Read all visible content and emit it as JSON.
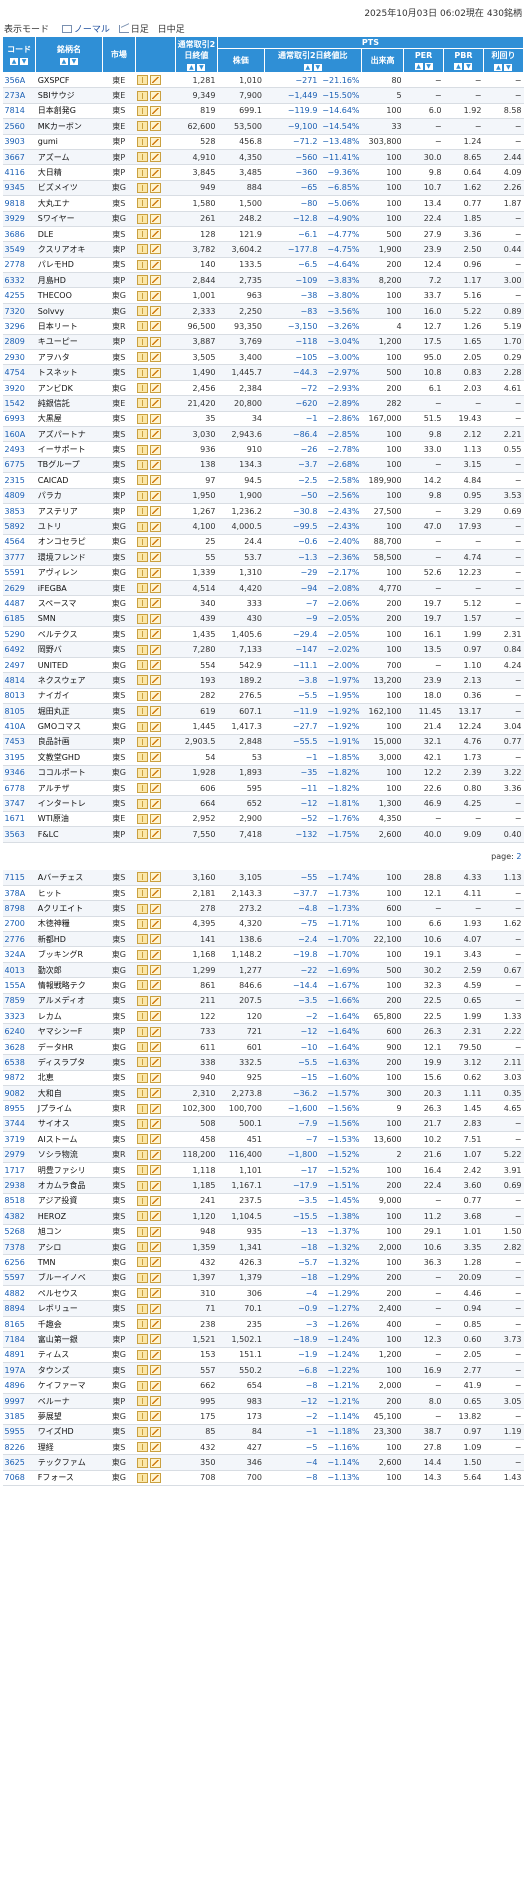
{
  "header": {
    "view_mode_label": "表示モード",
    "mode_normal": "ノーマル",
    "mode_daily": "日足",
    "mode_intraday": "日中足",
    "timestamp": "2025年10月03日 06:02現在",
    "count": "430銘柄"
  },
  "columns": {
    "code": "コード",
    "name": "銘柄名",
    "market": "市場",
    "regular_close": "通常取引2日終値",
    "pts_group": "PTS",
    "price": "株価",
    "ratio": "通常取引2日終値比",
    "volume": "出来高",
    "per": "PER",
    "pbr": "PBR",
    "yield": "利回り"
  },
  "colors": {
    "header_bg": "#2f8fd6",
    "negative": "#1a5fb4",
    "code": "#1a5fb4"
  },
  "icons": [
    "book-icon",
    "chart-icon"
  ],
  "page_label": "page:",
  "page_number": "2",
  "rows": [
    [
      "356A",
      "GXSPCF",
      "東E",
      "1,281",
      "1,010",
      "−271",
      "−21.16%",
      "80",
      "−",
      "−",
      "−"
    ],
    [
      "273A",
      "SBIサウジ",
      "東E",
      "9,349",
      "7,900",
      "−1,449",
      "−15.50%",
      "5",
      "−",
      "−",
      "−"
    ],
    [
      "7814",
      "日本創発G",
      "東S",
      "819",
      "699.1",
      "−119.9",
      "−14.64%",
      "100",
      "6.0",
      "1.92",
      "8.58"
    ],
    [
      "2560",
      "MKカーボン",
      "東E",
      "62,600",
      "53,500",
      "−9,100",
      "−14.54%",
      "33",
      "−",
      "−",
      "−"
    ],
    [
      "3903",
      "gumi",
      "東P",
      "528",
      "456.8",
      "−71.2",
      "−13.48%",
      "303,800",
      "−",
      "1.24",
      "−"
    ],
    [
      "3667",
      "アズーム",
      "東P",
      "4,910",
      "4,350",
      "−560",
      "−11.41%",
      "100",
      "30.0",
      "8.65",
      "2.44"
    ],
    [
      "4116",
      "大日精",
      "東P",
      "3,845",
      "3,485",
      "−360",
      "−9.36%",
      "100",
      "9.8",
      "0.64",
      "4.09"
    ],
    [
      "9345",
      "ビズメイツ",
      "東G",
      "949",
      "884",
      "−65",
      "−6.85%",
      "100",
      "10.7",
      "1.62",
      "2.26"
    ],
    [
      "9818",
      "大丸エナ",
      "東S",
      "1,580",
      "1,500",
      "−80",
      "−5.06%",
      "100",
      "13.4",
      "0.77",
      "1.87"
    ],
    [
      "3929",
      "Sワイヤー",
      "東G",
      "261",
      "248.2",
      "−12.8",
      "−4.90%",
      "100",
      "22.4",
      "1.85",
      "−"
    ],
    [
      "3686",
      "DLE",
      "東S",
      "128",
      "121.9",
      "−6.1",
      "−4.77%",
      "500",
      "27.9",
      "3.36",
      "−"
    ],
    [
      "3549",
      "クスリアオキ",
      "東P",
      "3,782",
      "3,604.2",
      "−177.8",
      "−4.75%",
      "1,900",
      "23.9",
      "2.50",
      "0.44"
    ],
    [
      "2778",
      "パレモHD",
      "東S",
      "140",
      "133.5",
      "−6.5",
      "−4.64%",
      "200",
      "12.4",
      "0.96",
      "−"
    ],
    [
      "6332",
      "月島HD",
      "東P",
      "2,844",
      "2,735",
      "−109",
      "−3.83%",
      "8,200",
      "7.2",
      "1.17",
      "3.00"
    ],
    [
      "4255",
      "THECOO",
      "東G",
      "1,001",
      "963",
      "−38",
      "−3.80%",
      "100",
      "33.7",
      "5.16",
      "−"
    ],
    [
      "7320",
      "Solvvy",
      "東G",
      "2,333",
      "2,250",
      "−83",
      "−3.56%",
      "100",
      "16.0",
      "5.22",
      "0.89"
    ],
    [
      "3296",
      "日本リート",
      "東R",
      "96,500",
      "93,350",
      "−3,150",
      "−3.26%",
      "4",
      "12.7",
      "1.26",
      "5.19"
    ],
    [
      "2809",
      "キユーピー",
      "東P",
      "3,887",
      "3,769",
      "−118",
      "−3.04%",
      "1,200",
      "17.5",
      "1.65",
      "1.70"
    ],
    [
      "2930",
      "アヲハタ",
      "東S",
      "3,505",
      "3,400",
      "−105",
      "−3.00%",
      "100",
      "95.0",
      "2.05",
      "0.29"
    ],
    [
      "4754",
      "トスネット",
      "東S",
      "1,490",
      "1,445.7",
      "−44.3",
      "−2.97%",
      "500",
      "10.8",
      "0.83",
      "2.28"
    ],
    [
      "3920",
      "アンビDK",
      "東G",
      "2,456",
      "2,384",
      "−72",
      "−2.93%",
      "200",
      "6.1",
      "2.03",
      "4.61"
    ],
    [
      "1542",
      "純銀信託",
      "東E",
      "21,420",
      "20,800",
      "−620",
      "−2.89%",
      "282",
      "−",
      "−",
      "−"
    ],
    [
      "6993",
      "大黒屋",
      "東S",
      "35",
      "34",
      "−1",
      "−2.86%",
      "167,000",
      "51.5",
      "19.43",
      "−"
    ],
    [
      "160A",
      "アズパートナ",
      "東S",
      "3,030",
      "2,943.6",
      "−86.4",
      "−2.85%",
      "100",
      "9.8",
      "2.12",
      "2.21"
    ],
    [
      "2493",
      "イーサポート",
      "東S",
      "936",
      "910",
      "−26",
      "−2.78%",
      "100",
      "33.0",
      "1.13",
      "0.55"
    ],
    [
      "6775",
      "TBグループ",
      "東S",
      "138",
      "134.3",
      "−3.7",
      "−2.68%",
      "100",
      "−",
      "3.15",
      "−"
    ],
    [
      "2315",
      "CAICAD",
      "東S",
      "97",
      "94.5",
      "−2.5",
      "−2.58%",
      "189,900",
      "14.2",
      "4.84",
      "−"
    ],
    [
      "4809",
      "パラカ",
      "東P",
      "1,950",
      "1,900",
      "−50",
      "−2.56%",
      "100",
      "9.8",
      "0.95",
      "3.53"
    ],
    [
      "3853",
      "アステリア",
      "東P",
      "1,267",
      "1,236.2",
      "−30.8",
      "−2.43%",
      "27,500",
      "−",
      "3.29",
      "0.69"
    ],
    [
      "5892",
      "ユトリ",
      "東G",
      "4,100",
      "4,000.5",
      "−99.5",
      "−2.43%",
      "100",
      "47.0",
      "17.93",
      "−"
    ],
    [
      "4564",
      "オンコセラピ",
      "東G",
      "25",
      "24.4",
      "−0.6",
      "−2.40%",
      "88,700",
      "−",
      "−",
      "−"
    ],
    [
      "3777",
      "環境フレンド",
      "東S",
      "55",
      "53.7",
      "−1.3",
      "−2.36%",
      "58,500",
      "−",
      "4.74",
      "−"
    ],
    [
      "5591",
      "アヴィレン",
      "東G",
      "1,339",
      "1,310",
      "−29",
      "−2.17%",
      "100",
      "52.6",
      "12.23",
      "−"
    ],
    [
      "2629",
      "iFEGBA",
      "東E",
      "4,514",
      "4,420",
      "−94",
      "−2.08%",
      "4,770",
      "−",
      "−",
      "−"
    ],
    [
      "4487",
      "スペースマ",
      "東G",
      "340",
      "333",
      "−7",
      "−2.06%",
      "200",
      "19.7",
      "5.12",
      "−"
    ],
    [
      "6185",
      "SMN",
      "東S",
      "439",
      "430",
      "−9",
      "−2.05%",
      "200",
      "19.7",
      "1.57",
      "−"
    ],
    [
      "5290",
      "ベルテクス",
      "東S",
      "1,435",
      "1,405.6",
      "−29.4",
      "−2.05%",
      "100",
      "16.1",
      "1.99",
      "2.31"
    ],
    [
      "6492",
      "岡野バ",
      "東S",
      "7,280",
      "7,133",
      "−147",
      "−2.02%",
      "100",
      "13.5",
      "0.97",
      "0.84"
    ],
    [
      "2497",
      "UNITED",
      "東G",
      "554",
      "542.9",
      "−11.1",
      "−2.00%",
      "700",
      "−",
      "1.10",
      "4.24"
    ],
    [
      "4814",
      "ネクスウェア",
      "東S",
      "193",
      "189.2",
      "−3.8",
      "−1.97%",
      "13,200",
      "23.9",
      "2.13",
      "−"
    ],
    [
      "8013",
      "ナイガイ",
      "東S",
      "282",
      "276.5",
      "−5.5",
      "−1.95%",
      "100",
      "18.0",
      "0.36",
      "−"
    ],
    [
      "8105",
      "堀田丸正",
      "東S",
      "619",
      "607.1",
      "−11.9",
      "−1.92%",
      "162,100",
      "11.45",
      "13.17",
      "−"
    ],
    [
      "410A",
      "GMOコマス",
      "東G",
      "1,445",
      "1,417.3",
      "−27.7",
      "−1.92%",
      "100",
      "21.4",
      "12.24",
      "3.04"
    ],
    [
      "7453",
      "良品計画",
      "東P",
      "2,903.5",
      "2,848",
      "−55.5",
      "−1.91%",
      "15,000",
      "32.1",
      "4.76",
      "0.77"
    ],
    [
      "3195",
      "文教堂GHD",
      "東S",
      "54",
      "53",
      "−1",
      "−1.85%",
      "3,000",
      "42.1",
      "1.73",
      "−"
    ],
    [
      "9346",
      "ココルポート",
      "東G",
      "1,928",
      "1,893",
      "−35",
      "−1.82%",
      "100",
      "12.2",
      "2.39",
      "3.22"
    ],
    [
      "6778",
      "アルチザ",
      "東S",
      "606",
      "595",
      "−11",
      "−1.82%",
      "100",
      "22.6",
      "0.80",
      "3.36"
    ],
    [
      "3747",
      "インタートレ",
      "東S",
      "664",
      "652",
      "−12",
      "−1.81%",
      "1,300",
      "46.9",
      "4.25",
      "−"
    ],
    [
      "1671",
      "WTI原油",
      "東E",
      "2,952",
      "2,900",
      "−52",
      "−1.76%",
      "4,350",
      "−",
      "−",
      "−"
    ],
    [
      "3563",
      "F&LC",
      "東P",
      "7,550",
      "7,418",
      "−132",
      "−1.75%",
      "2,600",
      "40.0",
      "9.09",
      "0.40"
    ],
    [
      "PAGE"
    ],
    [
      "7115",
      "Aバーチェス",
      "東S",
      "3,160",
      "3,105",
      "−55",
      "−1.74%",
      "100",
      "28.8",
      "4.33",
      "1.13"
    ],
    [
      "378A",
      "ヒット",
      "東S",
      "2,181",
      "2,143.3",
      "−37.7",
      "−1.73%",
      "100",
      "12.1",
      "4.11",
      "−"
    ],
    [
      "8798",
      "Aクリエイト",
      "東S",
      "278",
      "273.2",
      "−4.8",
      "−1.73%",
      "600",
      "−",
      "−",
      "−"
    ],
    [
      "2700",
      "木徳神糧",
      "東S",
      "4,395",
      "4,320",
      "−75",
      "−1.71%",
      "100",
      "6.6",
      "1.93",
      "1.62"
    ],
    [
      "2776",
      "新都HD",
      "東S",
      "141",
      "138.6",
      "−2.4",
      "−1.70%",
      "22,100",
      "10.6",
      "4.07",
      "−"
    ],
    [
      "324A",
      "ブッキングR",
      "東G",
      "1,168",
      "1,148.2",
      "−19.8",
      "−1.70%",
      "100",
      "19.1",
      "3.43",
      "−"
    ],
    [
      "4013",
      "勤次郎",
      "東G",
      "1,299",
      "1,277",
      "−22",
      "−1.69%",
      "500",
      "30.2",
      "2.59",
      "0.67"
    ],
    [
      "155A",
      "情報戦略テク",
      "東G",
      "861",
      "846.6",
      "−14.4",
      "−1.67%",
      "100",
      "32.3",
      "4.59",
      "−"
    ],
    [
      "7859",
      "アルメディオ",
      "東S",
      "211",
      "207.5",
      "−3.5",
      "−1.66%",
      "200",
      "22.5",
      "0.65",
      "−"
    ],
    [
      "3323",
      "レカム",
      "東S",
      "122",
      "120",
      "−2",
      "−1.64%",
      "65,800",
      "22.5",
      "1.99",
      "1.33"
    ],
    [
      "6240",
      "ヤマシンーF",
      "東P",
      "733",
      "721",
      "−12",
      "−1.64%",
      "600",
      "26.3",
      "2.31",
      "2.22"
    ],
    [
      "3628",
      "データHR",
      "東G",
      "611",
      "601",
      "−10",
      "−1.64%",
      "900",
      "12.1",
      "79.50",
      "−"
    ],
    [
      "6538",
      "ディスラプタ",
      "東S",
      "338",
      "332.5",
      "−5.5",
      "−1.63%",
      "200",
      "19.9",
      "3.12",
      "2.11"
    ],
    [
      "9872",
      "北恵",
      "東S",
      "940",
      "925",
      "−15",
      "−1.60%",
      "100",
      "15.6",
      "0.62",
      "3.03"
    ],
    [
      "9082",
      "大和自",
      "東S",
      "2,310",
      "2,273.8",
      "−36.2",
      "−1.57%",
      "300",
      "20.3",
      "1.11",
      "0.35"
    ],
    [
      "8955",
      "Jプライム",
      "東R",
      "102,300",
      "100,700",
      "−1,600",
      "−1.56%",
      "9",
      "26.3",
      "1.45",
      "4.65"
    ],
    [
      "3744",
      "サイオス",
      "東S",
      "508",
      "500.1",
      "−7.9",
      "−1.56%",
      "100",
      "21.7",
      "2.83",
      "−"
    ],
    [
      "3719",
      "AIストーム",
      "東S",
      "458",
      "451",
      "−7",
      "−1.53%",
      "13,600",
      "10.2",
      "7.51",
      "−"
    ],
    [
      "2979",
      "ソシラ物流",
      "東R",
      "118,200",
      "116,400",
      "−1,800",
      "−1.52%",
      "2",
      "21.6",
      "1.07",
      "5.22"
    ],
    [
      "1717",
      "明豊ファシリ",
      "東S",
      "1,118",
      "1,101",
      "−17",
      "−1.52%",
      "100",
      "16.4",
      "2.42",
      "3.91"
    ],
    [
      "2938",
      "オカムラ食品",
      "東S",
      "1,185",
      "1,167.1",
      "−17.9",
      "−1.51%",
      "200",
      "22.4",
      "3.60",
      "0.69"
    ],
    [
      "8518",
      "アジア投資",
      "東S",
      "241",
      "237.5",
      "−3.5",
      "−1.45%",
      "9,000",
      "−",
      "0.77",
      "−"
    ],
    [
      "4382",
      "HEROZ",
      "東S",
      "1,120",
      "1,104.5",
      "−15.5",
      "−1.38%",
      "100",
      "11.2",
      "3.68",
      "−"
    ],
    [
      "5268",
      "旭コン",
      "東S",
      "948",
      "935",
      "−13",
      "−1.37%",
      "100",
      "29.1",
      "1.01",
      "1.50"
    ],
    [
      "7378",
      "アシロ",
      "東G",
      "1,359",
      "1,341",
      "−18",
      "−1.32%",
      "2,000",
      "10.6",
      "3.35",
      "2.82"
    ],
    [
      "6256",
      "TMN",
      "東G",
      "432",
      "426.3",
      "−5.7",
      "−1.32%",
      "100",
      "36.3",
      "1.28",
      "−"
    ],
    [
      "5597",
      "ブルーイノベ",
      "東G",
      "1,397",
      "1,379",
      "−18",
      "−1.29%",
      "200",
      "−",
      "20.09",
      "−"
    ],
    [
      "4882",
      "ペルセウス",
      "東G",
      "310",
      "306",
      "−4",
      "−1.29%",
      "200",
      "−",
      "4.46",
      "−"
    ],
    [
      "8894",
      "レボリュー",
      "東S",
      "71",
      "70.1",
      "−0.9",
      "−1.27%",
      "2,400",
      "−",
      "0.94",
      "−"
    ],
    [
      "8165",
      "千趣会",
      "東S",
      "238",
      "235",
      "−3",
      "−1.26%",
      "400",
      "−",
      "0.85",
      "−"
    ],
    [
      "7184",
      "富山第一銀",
      "東P",
      "1,521",
      "1,502.1",
      "−18.9",
      "−1.24%",
      "100",
      "12.3",
      "0.60",
      "3.73"
    ],
    [
      "4891",
      "ティムス",
      "東G",
      "153",
      "151.1",
      "−1.9",
      "−1.24%",
      "1,200",
      "−",
      "2.05",
      "−"
    ],
    [
      "197A",
      "タウンズ",
      "東S",
      "557",
      "550.2",
      "−6.8",
      "−1.22%",
      "100",
      "16.9",
      "2.77",
      "−"
    ],
    [
      "4896",
      "ケイファーマ",
      "東G",
      "662",
      "654",
      "−8",
      "−1.21%",
      "2,000",
      "−",
      "41.9",
      "−"
    ],
    [
      "9997",
      "ベルーナ",
      "東P",
      "995",
      "983",
      "−12",
      "−1.21%",
      "200",
      "8.0",
      "0.65",
      "3.05"
    ],
    [
      "3185",
      "夢展望",
      "東G",
      "175",
      "173",
      "−2",
      "−1.14%",
      "45,100",
      "−",
      "13.82",
      "−"
    ],
    [
      "5955",
      "ワイズHD",
      "東S",
      "85",
      "84",
      "−1",
      "−1.18%",
      "23,300",
      "38.7",
      "0.97",
      "1.19"
    ],
    [
      "8226",
      "理経",
      "東S",
      "432",
      "427",
      "−5",
      "−1.16%",
      "100",
      "27.8",
      "1.09",
      "−"
    ],
    [
      "3625",
      "テックファム",
      "東G",
      "350",
      "346",
      "−4",
      "−1.14%",
      "2,600",
      "14.4",
      "1.50",
      "−"
    ],
    [
      "7068",
      "Fフォース",
      "東G",
      "708",
      "700",
      "−8",
      "−1.13%",
      "100",
      "14.3",
      "5.64",
      "1.43"
    ]
  ]
}
